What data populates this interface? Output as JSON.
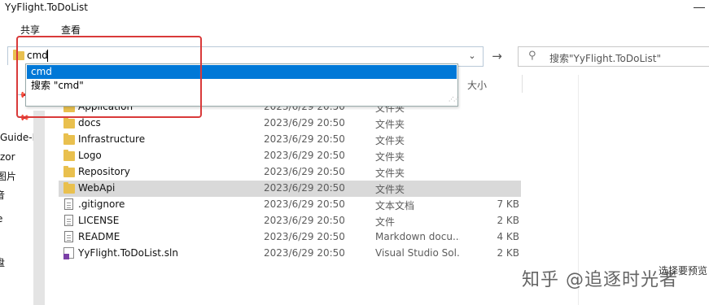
{
  "window": {
    "title": "YyFlight.ToDoList"
  },
  "menu": {
    "share": "共享",
    "view": "查看"
  },
  "address": {
    "value": "cmd",
    "dropdown_icon": "chevron-down-icon",
    "go_icon": "arrow-right-icon"
  },
  "search": {
    "placeholder": "搜索\"YyFlight.ToDoList\""
  },
  "suggestions": [
    {
      "label": "cmd",
      "selected": true
    },
    {
      "label": "搜索 \"cmd\"",
      "selected": false
    }
  ],
  "columns": {
    "size": "大小"
  },
  "nav": {
    "items": [
      "Guide-L",
      "zor",
      "图片",
      "音",
      "e",
      "盘"
    ]
  },
  "files": [
    {
      "name": "Application",
      "date": "2023/6/29 20:50",
      "type": "文件夹",
      "size": "",
      "icon": "folder-icon"
    },
    {
      "name": "docs",
      "date": "2023/6/29 20:50",
      "type": "文件夹",
      "size": "",
      "icon": "folder-icon"
    },
    {
      "name": "Infrastructure",
      "date": "2023/6/29 20:50",
      "type": "文件夹",
      "size": "",
      "icon": "folder-icon"
    },
    {
      "name": "Logo",
      "date": "2023/6/29 20:50",
      "type": "文件夹",
      "size": "",
      "icon": "folder-icon"
    },
    {
      "name": "Repository",
      "date": "2023/6/29 20:50",
      "type": "文件夹",
      "size": "",
      "icon": "folder-icon"
    },
    {
      "name": "WebApi",
      "date": "2023/6/29 20:50",
      "type": "文件夹",
      "size": "",
      "icon": "folder-icon",
      "selected": true
    },
    {
      "name": ".gitignore",
      "date": "2023/6/29 20:50",
      "type": "文本文档",
      "size": "7 KB",
      "icon": "text-file-icon"
    },
    {
      "name": "LICENSE",
      "date": "2023/6/29 20:50",
      "type": "文件",
      "size": "2 KB",
      "icon": "file-icon"
    },
    {
      "name": "README",
      "date": "2023/6/29 20:50",
      "type": "Markdown docu...",
      "size": "4 KB",
      "icon": "markdown-file-icon"
    },
    {
      "name": "YyFlight.ToDoList.sln",
      "date": "2023/6/29 20:50",
      "type": "Visual Studio Sol...",
      "size": "2 KB",
      "icon": "solution-file-icon"
    }
  ],
  "watermark": {
    "text": "知乎 @追逐时光者",
    "fragment": "选择要预览"
  },
  "colors": {
    "selection": "#0078d7",
    "highlight_box": "#d93a3a",
    "folder": "#e9c04e"
  }
}
